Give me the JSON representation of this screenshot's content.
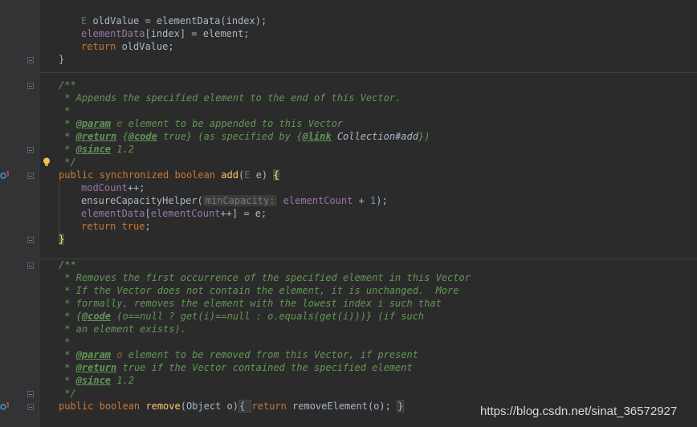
{
  "code": {
    "l0_a": "E",
    "l0_b": " oldValue = elementData(index);",
    "l1_a": "elementData",
    "l1_b": "[index] = element;",
    "l2_a": "return",
    "l2_b": " oldValue;",
    "l3": "}",
    "l5": "/**",
    "l6": " * Appends the specified element to the end of this Vector.",
    "l7": " *",
    "l8_a": " * ",
    "l8_tag": "@param",
    "l8_v": " e",
    "l8_b": " element to be appended to this Vector",
    "l9_a": " * ",
    "l9_tag": "@return",
    "l9_b": " {",
    "l9_code": "@code",
    "l9_c": " true} (as specified by {",
    "l9_link": "@link",
    "l9_ref": " Collection#add",
    "l9_d": "})",
    "l10_a": " * ",
    "l10_tag": "@since",
    "l10_b": " 1.2",
    "l11": " */",
    "l12_kw1": "public synchronized boolean",
    "l12_fn": " add",
    "l12_p1": "(",
    "l12_gen": "E",
    "l12_p2": " e) ",
    "l12_brace": "{",
    "l13_fld": "modCount",
    "l13_b": "++;",
    "l14_a": "ensureCapacityHelper(",
    "l14_hint": "minCapacity:",
    "l14_fld": " elementCount",
    "l14_b": " + ",
    "l14_num": "1",
    "l14_c": ");",
    "l15_fld1": "elementData",
    "l15_b": "[",
    "l15_fld2": "elementCount",
    "l15_c": "++] = e;",
    "l16_kw": "return true",
    "l16_b": ";",
    "l17": "}",
    "l19": "/**",
    "l20": " * Removes the first occurrence of the specified element in this Vector",
    "l21": " * If the Vector does not contain the element, it is unchanged.  More",
    "l22": " * formally, removes the element with the lowest index i such that",
    "l23_a": " * {",
    "l23_code": "@code",
    "l23_b": " (o==null ? get(i)==null : o.equals(get(i)))} (if such",
    "l24": " * an element exists).",
    "l25": " *",
    "l26_a": " * ",
    "l26_tag": "@param",
    "l26_v": " o",
    "l26_b": " element to be removed from this Vector, if present",
    "l27_a": " * ",
    "l27_tag": "@return",
    "l27_b": " true if the Vector contained the specified element",
    "l28_a": " * ",
    "l28_tag": "@since",
    "l28_b": " 1.2",
    "l29": " */",
    "l30_kw": "public boolean",
    "l30_fn": " remove",
    "l30_a": "(Object o)",
    "l30_fold_open": "{ ",
    "l30_kw2": "return",
    "l30_b": " removeElement(o); ",
    "l30_fold_close": "}"
  },
  "watermark": "https://blog.csdn.net/sinat_36572927",
  "colors": {
    "background": "#2b2b2b",
    "keyword": "#cc7832",
    "comment": "#629755",
    "method": "#ffc66d",
    "field": "#9876aa",
    "number": "#6897bb"
  },
  "icons": [
    "override-marker-icon",
    "fold-marker-icon",
    "lightbulb-icon"
  ]
}
